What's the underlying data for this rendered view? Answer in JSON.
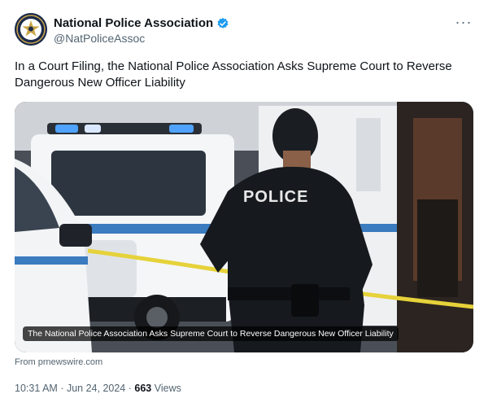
{
  "author": {
    "display_name": "National Police Association",
    "handle": "@NatPoliceAssoc",
    "verified": true,
    "avatar_icon": "police-badge-logo"
  },
  "more_label": "···",
  "text_lines": [
    "In a Court Filing, the National Police Association Asks Supreme Court to Reverse",
    "Dangerous New Officer Liability"
  ],
  "media": {
    "caption": "The National Police Association Asks Supreme Court to Reverse Dangerous New Officer Liability",
    "vest_text": "POLICE"
  },
  "source": "From prnewswire.com",
  "meta": {
    "time": "10:31 AM",
    "separator": "·",
    "date": "Jun 24, 2024",
    "views_count": "663",
    "views_label": "Views"
  },
  "colors": {
    "verified": "#1d9bf0",
    "secondary_text": "#536471",
    "primary_text": "#0f1419"
  }
}
